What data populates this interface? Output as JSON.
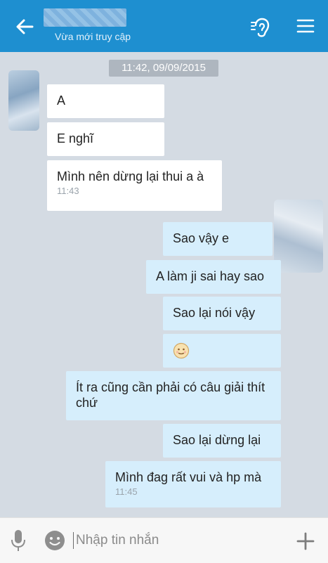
{
  "header": {
    "subtitle": "Vừa mới truy cập"
  },
  "date_separator": "11:42, 09/09/2015",
  "messages": [
    {
      "side": "in",
      "text": "A"
    },
    {
      "side": "in",
      "text": "E nghĩ"
    },
    {
      "side": "in",
      "text": "Mình nên dừng lại thui a à",
      "time": "11:43"
    },
    {
      "side": "out",
      "text": "Sao vậy e"
    },
    {
      "side": "out",
      "text": "A làm ji sai hay sao"
    },
    {
      "side": "out",
      "text": "Sao lại nói vậy"
    },
    {
      "side": "out",
      "text": "",
      "emoji": "smile-emoji"
    },
    {
      "side": "out",
      "text": "Ít ra cũng cần phải có câu giải thít chứ"
    },
    {
      "side": "out",
      "text": "Sao lại dừng lại"
    },
    {
      "side": "out",
      "text": "Mình đag rất vui và hp mà",
      "time": "11:45"
    }
  ],
  "composer": {
    "placeholder": "Nhập tin nhắn"
  },
  "colors": {
    "header": "#1e8fd0",
    "background": "#d4dbe3",
    "incoming": "#ffffff",
    "outgoing": "#d6eefc"
  },
  "icons": [
    "back-arrow-icon",
    "ear-icon",
    "menu-icon",
    "mic-icon",
    "emoji-icon",
    "plus-icon"
  ]
}
